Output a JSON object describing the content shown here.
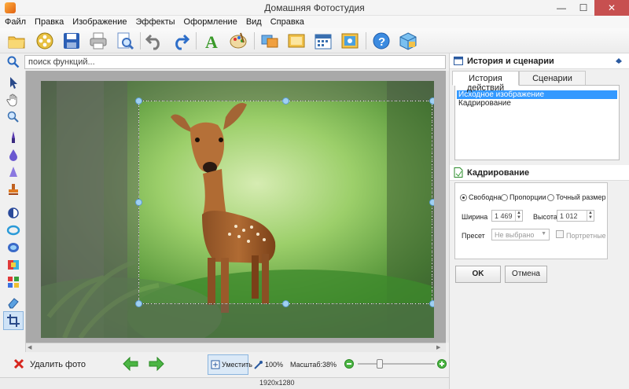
{
  "window": {
    "title": "Домашняя Фотостудия",
    "minimize": "—",
    "maximize": "☐",
    "close": "✕"
  },
  "menu": [
    "Файл",
    "Правка",
    "Изображение",
    "Эффекты",
    "Оформление",
    "Вид",
    "Справка"
  ],
  "toolbar_icons": [
    "open-folder-icon",
    "film-reel-icon",
    "save-icon",
    "print-icon",
    "preview-icon",
    "undo-icon",
    "redo-icon",
    "text-icon",
    "palette-icon",
    "collage-icon",
    "frame-icon",
    "calendar-icon",
    "card-icon",
    "help-icon",
    "box-icon"
  ],
  "search": {
    "placeholder": "поиск функций..."
  },
  "left_tools": [
    "pointer-icon",
    "hand-icon",
    "zoom-icon",
    "brush-icon",
    "drop-icon",
    "sharpen-icon",
    "stamp-icon",
    "contrast-icon",
    "ring-icon",
    "lens-icon",
    "layers-icon",
    "grid-icon",
    "eraser-icon",
    "crop-icon"
  ],
  "right": {
    "history_title": "История и сценарии",
    "tabs": [
      "История действий",
      "Сценарии"
    ],
    "history": [
      "Исходное изображение",
      "Кадрирование"
    ],
    "crop_title": "Кадрирование",
    "modes": [
      "Свободная",
      "Пропорции",
      "Точный размер"
    ],
    "width_label": "Ширина",
    "width_value": "1 469",
    "height_label": "Высота",
    "height_value": "1 012",
    "preset_label": "Пресет",
    "preset_value": "Не выбрано",
    "portrait_label": "Портретные",
    "ok": "OK",
    "cancel": "Отмена"
  },
  "bottom": {
    "delete_label": "Удалить фото",
    "fit_label": "Уместить",
    "zoom100_label": "100%",
    "scale_label": "Масштаб:",
    "scale_value": "38%"
  },
  "status": {
    "resolution": "1920x1280"
  },
  "colors": {
    "accent": "#3399ff",
    "crop_handle": "#9fd0f2",
    "delete_x": "#d7261e",
    "arrow_green": "#4cb544"
  }
}
